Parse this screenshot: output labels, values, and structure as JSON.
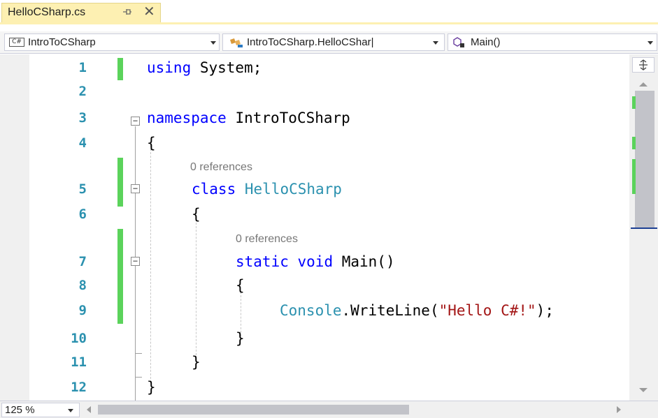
{
  "tab": {
    "title": "HelloCSharp.cs",
    "pin_icon": "pin-icon",
    "close_glyph": "✕"
  },
  "navbar": {
    "project": "IntroToCSharp",
    "project_icon": "C#",
    "class": "IntroToCSharp.HelloCShar|",
    "member": "Main()"
  },
  "editor": {
    "lines": [
      {
        "num": "1",
        "tokens": [
          {
            "t": "using",
            "c": "kw"
          },
          {
            "t": " System;",
            "c": ""
          }
        ]
      },
      {
        "num": "2",
        "tokens": []
      },
      {
        "num": "3",
        "tokens": [
          {
            "t": "namespace",
            "c": "kw"
          },
          {
            "t": " IntroToCSharp",
            "c": ""
          }
        ]
      },
      {
        "num": "4",
        "tokens": [
          {
            "t": "{",
            "c": ""
          }
        ]
      },
      {
        "num": "5",
        "lens": "0 references",
        "tokens": [
          {
            "t": "class",
            "c": "kw"
          },
          {
            "t": " ",
            "c": ""
          },
          {
            "t": "HelloCSharp",
            "c": "ty"
          }
        ]
      },
      {
        "num": "6",
        "tokens": [
          {
            "t": "{",
            "c": ""
          }
        ]
      },
      {
        "num": "7",
        "lens": "0 references",
        "tokens": [
          {
            "t": "static",
            "c": "kw"
          },
          {
            "t": " ",
            "c": ""
          },
          {
            "t": "void",
            "c": "kw"
          },
          {
            "t": " Main()",
            "c": ""
          }
        ]
      },
      {
        "num": "8",
        "tokens": [
          {
            "t": "{",
            "c": ""
          }
        ]
      },
      {
        "num": "9",
        "tokens": [
          {
            "t": "Console",
            "c": "ty"
          },
          {
            "t": ".WriteLine(",
            "c": ""
          },
          {
            "t": "\"Hello C#!\"",
            "c": "str"
          },
          {
            "t": ");",
            "c": ""
          }
        ]
      },
      {
        "num": "10",
        "tokens": [
          {
            "t": "}",
            "c": ""
          }
        ]
      },
      {
        "num": "11",
        "tokens": [
          {
            "t": "}",
            "c": ""
          }
        ]
      },
      {
        "num": "12",
        "tokens": [
          {
            "t": "}",
            "c": ""
          }
        ]
      }
    ]
  },
  "statusbar": {
    "zoom": "125 %"
  },
  "colors": {
    "keyword": "#0000ff",
    "type": "#2b91af",
    "string": "#a31515",
    "change_bar": "#5bd35b",
    "tab_bg": "#fdf0b2"
  }
}
